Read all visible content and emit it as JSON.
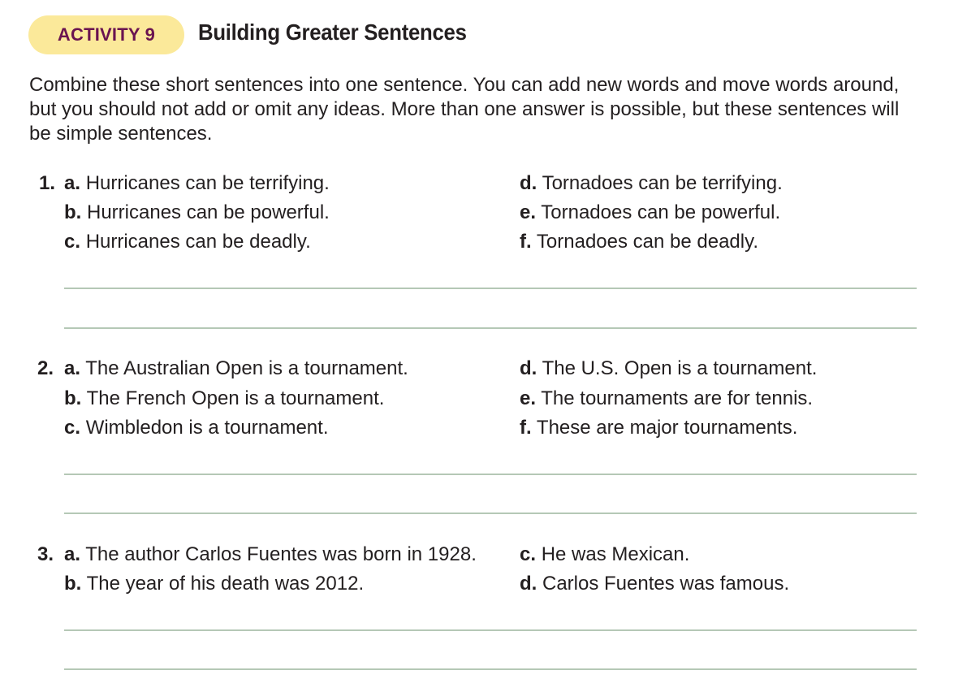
{
  "activity": {
    "badge": "ACTIVITY 9",
    "title": "Building Greater Sentences",
    "instructions": "Combine these short sentences into one sentence. You can add new words and move words around, but you should not add or omit any ideas. More than one answer is possible, but these sentences will be simple sentences."
  },
  "items": [
    {
      "number": "1.",
      "left": [
        {
          "label": "a.",
          "text": "Hurricanes can be terrifying."
        },
        {
          "label": "b.",
          "text": "Hurricanes can be powerful."
        },
        {
          "label": "c.",
          "text": "Hurricanes can be deadly."
        }
      ],
      "right": [
        {
          "label": "d.",
          "text": "Tornadoes can be terrifying."
        },
        {
          "label": "e.",
          "text": "Tornadoes can be powerful."
        },
        {
          "label": "f.",
          "text": "Tornadoes can be deadly."
        }
      ]
    },
    {
      "number": "2.",
      "left": [
        {
          "label": "a.",
          "text": "The Australian Open is a tournament."
        },
        {
          "label": "b.",
          "text": "The French Open is a tournament."
        },
        {
          "label": "c.",
          "text": "Wimbledon is a tournament."
        }
      ],
      "right": [
        {
          "label": "d.",
          "text": "The U.S. Open is a tournament."
        },
        {
          "label": "e.",
          "text": "The tournaments are for tennis."
        },
        {
          "label": "f.",
          "text": "These are major tournaments."
        }
      ]
    },
    {
      "number": "3.",
      "left": [
        {
          "label": "a.",
          "text": "The author Carlos Fuentes was born in 1928."
        },
        {
          "label": "b.",
          "text": "The year of his death was 2012."
        }
      ],
      "right": [
        {
          "label": "c.",
          "text": "He was Mexican."
        },
        {
          "label": "d.",
          "text": "Carlos Fuentes was famous."
        }
      ]
    }
  ]
}
